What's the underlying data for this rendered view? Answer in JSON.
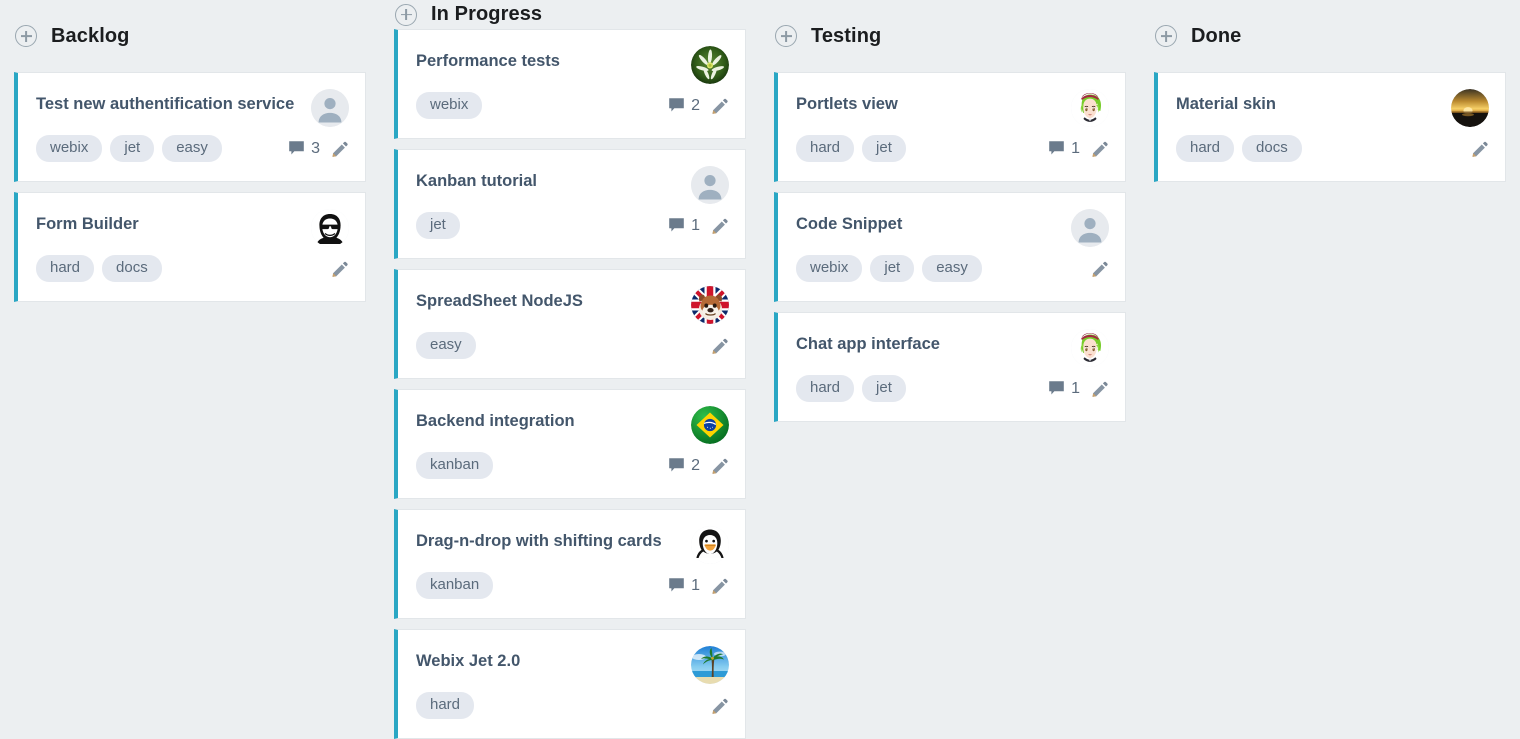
{
  "board": {
    "columns": [
      {
        "id": "backlog",
        "title": "Backlog",
        "add_icon": "plus-circle-icon",
        "cards": [
          {
            "title": "Test new authentification service",
            "tags": [
              "webix",
              "jet",
              "easy"
            ],
            "comments": "3",
            "avatar": "default-person-avatar",
            "edit_icon": "pencil-icon",
            "comment_icon": "comment-icon",
            "accent": "#2aa7c4"
          },
          {
            "title": "Form Builder",
            "tags": [
              "hard",
              "docs"
            ],
            "comments": "",
            "avatar": "sunglasses-face-avatar",
            "edit_icon": "pencil-icon",
            "comment_icon": "comment-icon",
            "accent": "#2aa7c4"
          }
        ]
      },
      {
        "id": "in-progress",
        "title": "In Progress",
        "add_icon": "plus-circle-icon",
        "cards": [
          {
            "title": "Performance tests",
            "tags": [
              "webix"
            ],
            "comments": "2",
            "avatar": "white-flower-avatar",
            "edit_icon": "pencil-icon",
            "comment_icon": "comment-icon",
            "accent": "#2aa7c4"
          },
          {
            "title": "Kanban tutorial",
            "tags": [
              "jet"
            ],
            "comments": "1",
            "avatar": "default-person-avatar",
            "edit_icon": "pencil-icon",
            "comment_icon": "comment-icon",
            "accent": "#2aa7c4"
          },
          {
            "title": "SpreadSheet NodeJS",
            "tags": [
              "easy"
            ],
            "comments": "",
            "avatar": "bulldog-union-jack-avatar",
            "edit_icon": "pencil-icon",
            "comment_icon": "comment-icon",
            "accent": "#2aa7c4"
          },
          {
            "title": "Backend integration",
            "tags": [
              "kanban"
            ],
            "comments": "2",
            "avatar": "brazil-flag-avatar",
            "edit_icon": "pencil-icon",
            "comment_icon": "comment-icon",
            "accent": "#2aa7c4"
          },
          {
            "title": "Drag-n-drop with shifting cards",
            "tags": [
              "kanban"
            ],
            "comments": "1",
            "avatar": "penguin-avatar",
            "edit_icon": "pencil-icon",
            "comment_icon": "comment-icon",
            "accent": "#2aa7c4"
          },
          {
            "title": "Webix Jet 2.0",
            "tags": [
              "hard"
            ],
            "comments": "",
            "avatar": "palm-beach-avatar",
            "edit_icon": "pencil-icon",
            "comment_icon": "comment-icon",
            "accent": "#2aa7c4"
          }
        ]
      },
      {
        "id": "testing",
        "title": "Testing",
        "add_icon": "plus-circle-icon",
        "cards": [
          {
            "title": "Portlets view",
            "tags": [
              "hard",
              "jet"
            ],
            "comments": "1",
            "avatar": "green-hair-anime-avatar",
            "edit_icon": "pencil-icon",
            "comment_icon": "comment-icon",
            "accent": "#2aa7c4"
          },
          {
            "title": "Code Snippet",
            "tags": [
              "webix",
              "jet",
              "easy"
            ],
            "comments": "",
            "avatar": "default-person-avatar",
            "edit_icon": "pencil-icon",
            "comment_icon": "comment-icon",
            "accent": "#2aa7c4"
          },
          {
            "title": "Chat app interface",
            "tags": [
              "hard",
              "jet"
            ],
            "comments": "1",
            "avatar": "green-hair-anime-avatar",
            "edit_icon": "pencil-icon",
            "comment_icon": "comment-icon",
            "accent": "#2aa7c4"
          }
        ]
      },
      {
        "id": "done",
        "title": "Done",
        "add_icon": "plus-circle-icon",
        "cards": [
          {
            "title": "Material skin",
            "tags": [
              "hard",
              "docs"
            ],
            "comments": "",
            "avatar": "sunset-photo-avatar",
            "edit_icon": "pencil-icon",
            "comment_icon": "comment-icon",
            "accent": "#2aa7c4"
          }
        ]
      }
    ]
  },
  "theme": {
    "background": "#eceff1",
    "card_background": "#ffffff",
    "accent": "#2aa7c4",
    "tag_background": "#e4e8ef",
    "tag_text": "#5b6b7c",
    "title_text": "#43566b",
    "header_text": "#1b1d1f"
  }
}
